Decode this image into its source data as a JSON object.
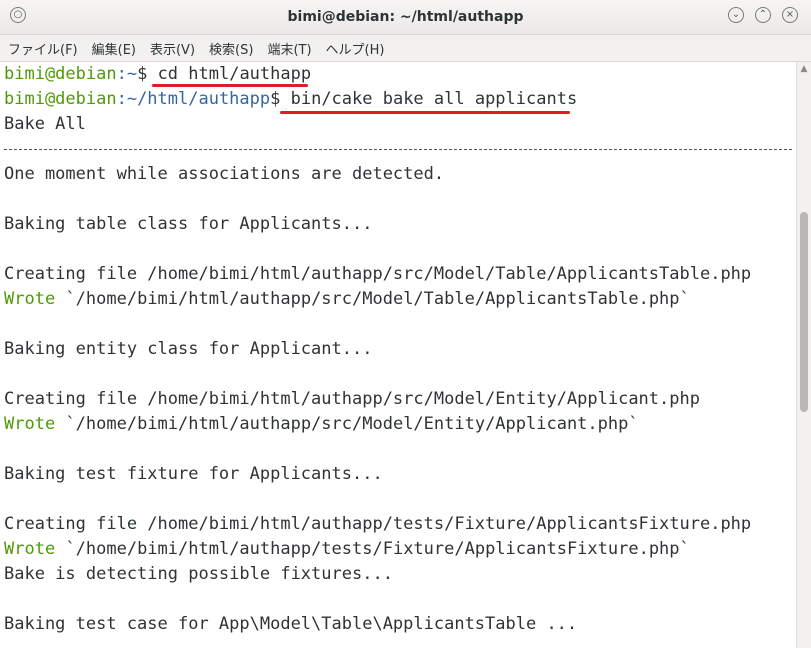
{
  "window": {
    "title": "bimi@debian: ~/html/authapp",
    "left_button_icon": "circle-icon",
    "buttons": [
      "minimize-button",
      "maximize-button",
      "close-button"
    ]
  },
  "menu": [
    "ファイル(F)",
    "編集(E)",
    "表示(V)",
    "検索(S)",
    "端末(T)",
    "ヘルプ(H)"
  ],
  "terminal": {
    "prompt1": {
      "user": "bimi@debian",
      "path": ":~",
      "dollar": "$",
      "command": " cd html/authapp"
    },
    "prompt2": {
      "user": "bimi@debian",
      "path": ":~/html/authapp",
      "dollar": "$",
      "command": " bin/cake bake all applicants"
    },
    "lines": {
      "bake_all": "Bake All",
      "detect": "One moment while associations are detected.",
      "bake_table": "Baking table class for Applicants...",
      "create_table": "Creating file /home/bimi/html/authapp/src/Model/Table/ApplicantsTable.php",
      "wrote_table": "`/home/bimi/html/authapp/src/Model/Table/ApplicantsTable.php`",
      "bake_entity": "Baking entity class for Applicant...",
      "create_entity": "Creating file /home/bimi/html/authapp/src/Model/Entity/Applicant.php",
      "wrote_entity": "`/home/bimi/html/authapp/src/Model/Entity/Applicant.php`",
      "bake_fixture": "Baking test fixture for Applicants...",
      "create_fixture": "Creating file /home/bimi/html/authapp/tests/Fixture/ApplicantsFixture.php",
      "wrote_fixture": "`/home/bimi/html/authapp/tests/Fixture/ApplicantsFixture.php`",
      "detect_fixtures": "Bake is detecting possible fixtures...",
      "bake_testcase": "Baking test case for App\\Model\\Table\\ApplicantsTable ..."
    },
    "wrote_label": "Wrote",
    "annotation_color": "#e01b24",
    "prompt_color": "#4e9a06",
    "path_color": "#3465a4"
  }
}
